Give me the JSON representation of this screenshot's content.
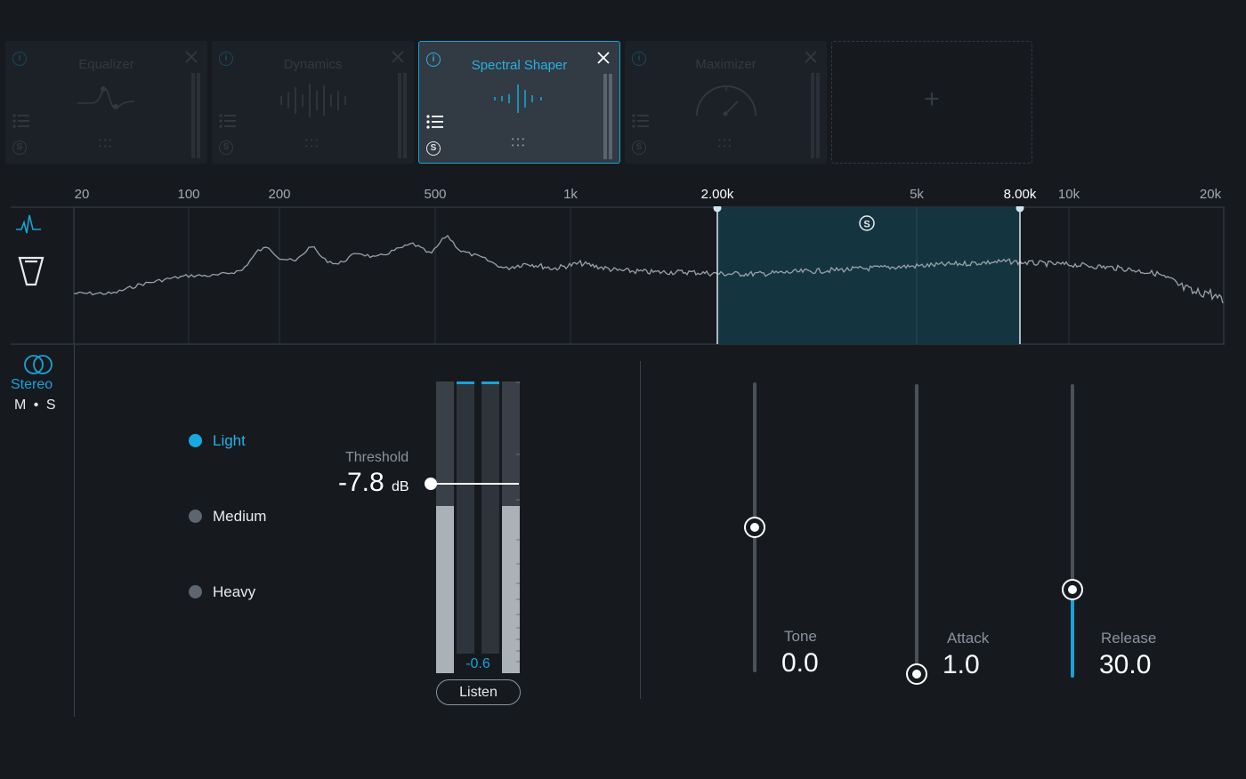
{
  "modules": [
    {
      "title": "Equalizer",
      "state": "bypassed",
      "graphic": "eq-curve"
    },
    {
      "title": "Dynamics",
      "state": "bypassed",
      "graphic": "dynamics-bars"
    },
    {
      "title": "Spectral Shaper",
      "state": "active",
      "graphic": "spectral-bars"
    },
    {
      "title": "Maximizer",
      "state": "bypassed",
      "graphic": "gauge"
    }
  ],
  "add_module_symbol": "+",
  "icons": {
    "info": "i",
    "solo": "S",
    "close": "close-icon",
    "list": "list-icon"
  },
  "spectrum": {
    "freq_ticks": [
      "20",
      "100",
      "200",
      "500",
      "1k",
      "5k",
      "10k",
      "20k"
    ],
    "band_low_label": "2.00k",
    "band_high_label": "8.00k",
    "band_low_hz": 2000,
    "band_high_hz": 8000,
    "band_solo": "S",
    "accent": "#1aa2d6",
    "band_fill": "#143440"
  },
  "stereo": {
    "mode_label": "Stereo",
    "ms_label": "M • S"
  },
  "modes": {
    "selected": "Light",
    "options": [
      "Light",
      "Medium",
      "Heavy"
    ]
  },
  "threshold": {
    "title": "Threshold",
    "value": "-7.8",
    "unit": "dB",
    "meter_readout": "-0.6",
    "listen_label": "Listen"
  },
  "controls": {
    "tone": {
      "label": "Tone",
      "value": "0.0",
      "level": 0.5
    },
    "attack": {
      "label": "Attack",
      "value": "1.0",
      "level": 0.0
    },
    "release": {
      "label": "Release",
      "value": "30.0",
      "level": 0.3
    }
  },
  "colors": {
    "background": "#161a1f",
    "accent": "#1aa2d6",
    "module_active": "#323a44"
  }
}
